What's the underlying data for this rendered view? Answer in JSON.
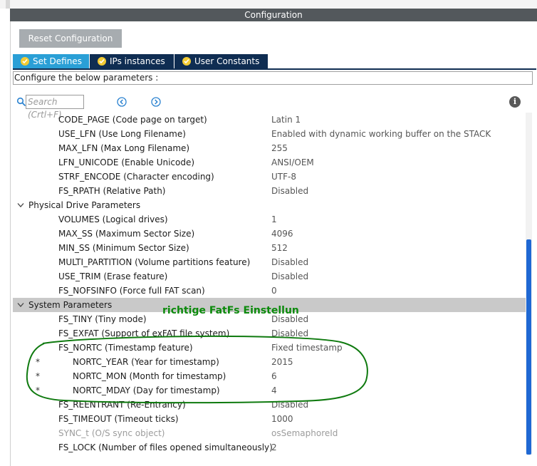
{
  "window": {
    "title": "Configuration"
  },
  "toolbar": {
    "reset_label": "Reset Configuration"
  },
  "tabs": [
    {
      "label": "Set Defines"
    },
    {
      "label": "IPs instances"
    },
    {
      "label": "User Constants"
    }
  ],
  "hint": "Configure the below parameters :",
  "search": {
    "placeholder": "Search (Crtl+F)"
  },
  "rows": [
    {
      "name": "CODE_PAGE (Code page on target)",
      "value": "Latin 1"
    },
    {
      "name": "USE_LFN (Use Long Filename)",
      "value": "Enabled with dynamic working buffer on the STACK"
    },
    {
      "name": "MAX_LFN (Max Long Filename)",
      "value": "255"
    },
    {
      "name": "LFN_UNICODE (Enable Unicode)",
      "value": "ANSI/OEM"
    },
    {
      "name": "STRF_ENCODE (Character encoding)",
      "value": "UTF-8"
    },
    {
      "name": "FS_RPATH (Relative Path)",
      "value": "Disabled"
    },
    {
      "name": "Physical Drive Parameters"
    },
    {
      "name": "VOLUMES (Logical drives)",
      "value": "1"
    },
    {
      "name": "MAX_SS (Maximum Sector Size)",
      "value": "4096"
    },
    {
      "name": "MIN_SS (Minimum Sector Size)",
      "value": "512"
    },
    {
      "name": "MULTI_PARTITION (Volume partitions feature)",
      "value": "Disabled"
    },
    {
      "name": "USE_TRIM (Erase feature)",
      "value": "Disabled"
    },
    {
      "name": "FS_NOFSINFO (Force full FAT scan)",
      "value": "0"
    },
    {
      "name": "System Parameters"
    },
    {
      "name": "FS_TINY (Tiny mode)",
      "value": "Disabled"
    },
    {
      "name": "FS_EXFAT (Support of exFAT file system)",
      "value": "Disabled"
    },
    {
      "name": "FS_NORTC (Timestamp feature)",
      "value": "Fixed timestamp"
    },
    {
      "name": "NORTC_YEAR (Year for timestamp)",
      "value": "2015",
      "marker": "*"
    },
    {
      "name": "NORTC_MON (Month for timestamp)",
      "value": "6",
      "marker": "*"
    },
    {
      "name": "NORTC_MDAY (Day for timestamp)",
      "value": "4",
      "marker": "*"
    },
    {
      "name": "FS_REENTRANT (Re-Entrancy)",
      "value": "Disabled"
    },
    {
      "name": "FS_TIMEOUT (Timeout ticks)",
      "value": "1000"
    },
    {
      "name": "SYNC_t (O/S sync object)",
      "value": "osSemaphoreId"
    },
    {
      "name": "FS_LOCK (Number of files opened simultaneously)",
      "value": "2"
    }
  ],
  "annotation": "richtige FatFs Einstellun",
  "colors": {
    "titlebar": "#53585c",
    "tab_active": "#2a9fd6",
    "tab_inactive": "#0f2d52",
    "scroll_thumb": "#1f68d3",
    "annotation": "#0c8a0c"
  },
  "icons": [
    "search-icon",
    "prev-icon",
    "next-icon",
    "info-icon",
    "check-icon",
    "chevron-down-icon"
  ]
}
